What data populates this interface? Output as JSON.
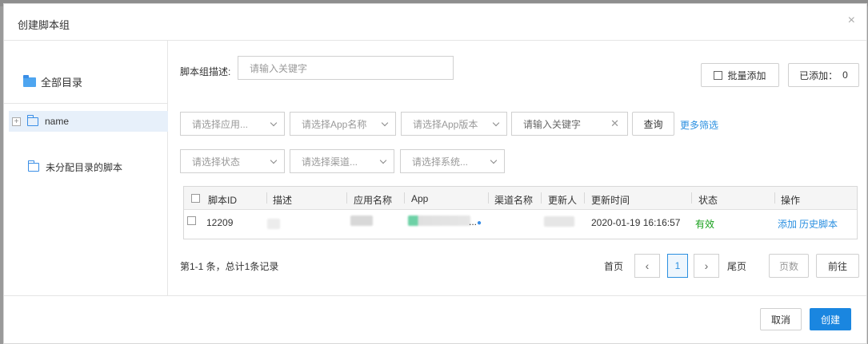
{
  "modal": {
    "title": "创建脚本组",
    "close": "×"
  },
  "sidebar": {
    "all": "全部目录",
    "name_node": "name",
    "unassigned": "未分配目录的脚本"
  },
  "filters": {
    "desc_label": "脚本组描述:",
    "desc_placeholder": "请输入关键字",
    "batch_add": "批量添加",
    "added_label": "已添加：",
    "added_count": "0",
    "app_type": "请选择应用...",
    "app_name": "请选择App名称",
    "app_version": "请选择App版本",
    "keyword_placeholder": "请输入关键字",
    "query": "查询",
    "more": "更多筛选",
    "status": "请选择状态",
    "channel": "请选择渠道...",
    "system": "请选择系统..."
  },
  "table": {
    "headers": [
      "脚本ID",
      "描述",
      "应用名称",
      "App",
      "渠道名称",
      "更新人",
      "更新时间",
      "状态",
      "操作"
    ],
    "rows": [
      {
        "id": "12209",
        "app_suffix": "...",
        "updated": "2020-01-19 16:16:57",
        "status": "有效",
        "action_add": "添加",
        "action_history": "历史脚本"
      }
    ]
  },
  "pager": {
    "info": "第1-1 条，总计1条记录",
    "first": "首页",
    "prev": "‹",
    "current": "1",
    "next": "›",
    "last": "尾页",
    "page_placeholder": "页数",
    "go": "前往"
  },
  "footer": {
    "cancel": "取消",
    "create": "创建"
  },
  "colors": {
    "primary": "#1a86e0",
    "link": "#2a8fe0",
    "valid": "#18a01c",
    "selected_row": "#e7f0fa"
  }
}
